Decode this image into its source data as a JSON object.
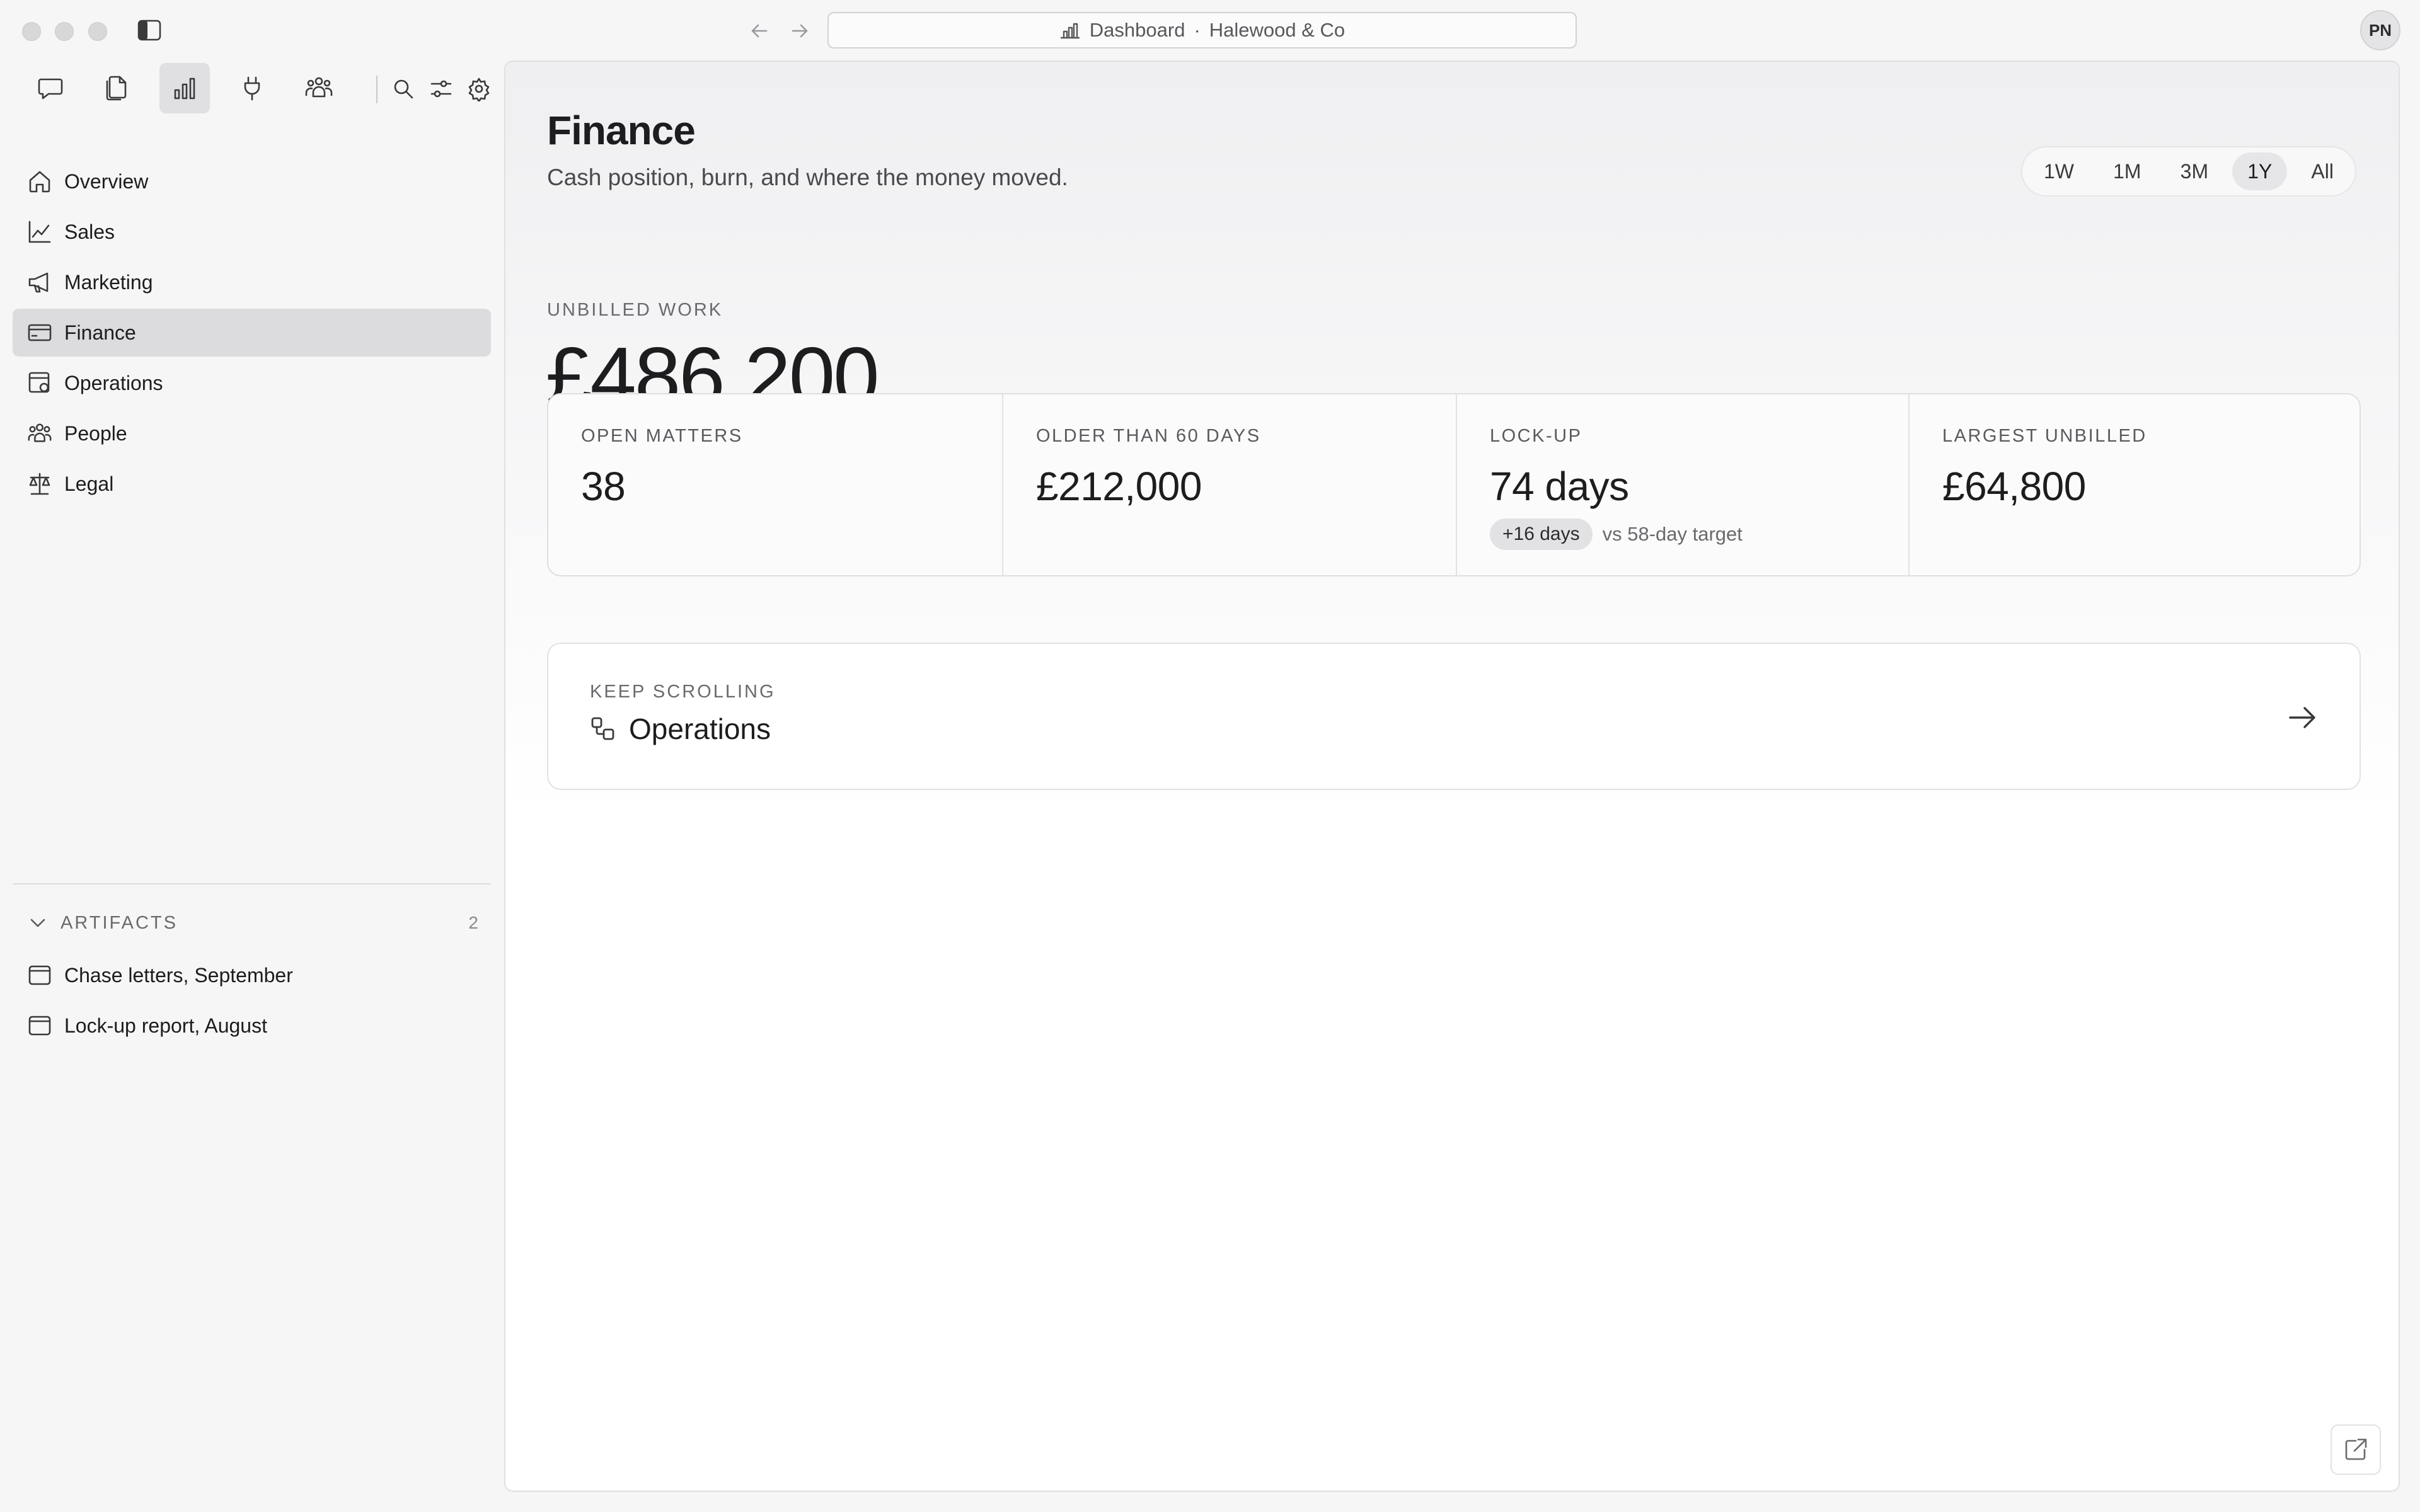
{
  "window": {
    "address": {
      "title": "Dashboard",
      "separator": "·",
      "workspace": "Halewood & Co"
    },
    "avatar_initials": "PN"
  },
  "toolbar": {
    "icons": [
      "chat-icon",
      "documents-icon",
      "bar-chart-icon",
      "plug-icon",
      "team-icon"
    ],
    "active_icon": "bar-chart-icon",
    "utility_icons": [
      "search-icon",
      "sliders-icon",
      "gear-icon"
    ]
  },
  "sidebar": {
    "items": [
      {
        "label": "Overview",
        "icon": "home-icon"
      },
      {
        "label": "Sales",
        "icon": "line-chart-icon"
      },
      {
        "label": "Marketing",
        "icon": "megaphone-icon"
      },
      {
        "label": "Finance",
        "icon": "credit-card-icon",
        "active": true
      },
      {
        "label": "Operations",
        "icon": "operations-icon"
      },
      {
        "label": "People",
        "icon": "people-icon"
      },
      {
        "label": "Legal",
        "icon": "scales-icon"
      }
    ],
    "artifacts": {
      "title": "ARTIFACTS",
      "count": "2",
      "items": [
        {
          "label": "Chase letters, September",
          "icon": "window-icon"
        },
        {
          "label": "Lock-up report, August",
          "icon": "window-icon"
        }
      ]
    }
  },
  "main": {
    "title": "Finance",
    "subtitle": "Cash position, burn, and where the money moved.",
    "ranges": [
      "1W",
      "1M",
      "3M",
      "1Y",
      "All"
    ],
    "active_range": "1Y",
    "headline": {
      "label": "UNBILLED WORK",
      "value": "£486,200"
    },
    "stats": [
      {
        "label": "OPEN MATTERS",
        "value": "38"
      },
      {
        "label": "OLDER THAN 60 DAYS",
        "value": "£212,000"
      },
      {
        "label": "LOCK-UP",
        "value": "74 days",
        "badge": "+16 days",
        "note": "vs 58-day target"
      },
      {
        "label": "LARGEST UNBILLED",
        "value": "£64,800"
      }
    ],
    "next": {
      "label": "KEEP SCROLLING",
      "title": "Operations",
      "icon": "operations-icon"
    }
  },
  "colors": {
    "accent_active": "#dcdcde",
    "text_primary": "#1d1d1f",
    "text_muted": "#6a6a6e",
    "background": "#f6f6f6"
  }
}
